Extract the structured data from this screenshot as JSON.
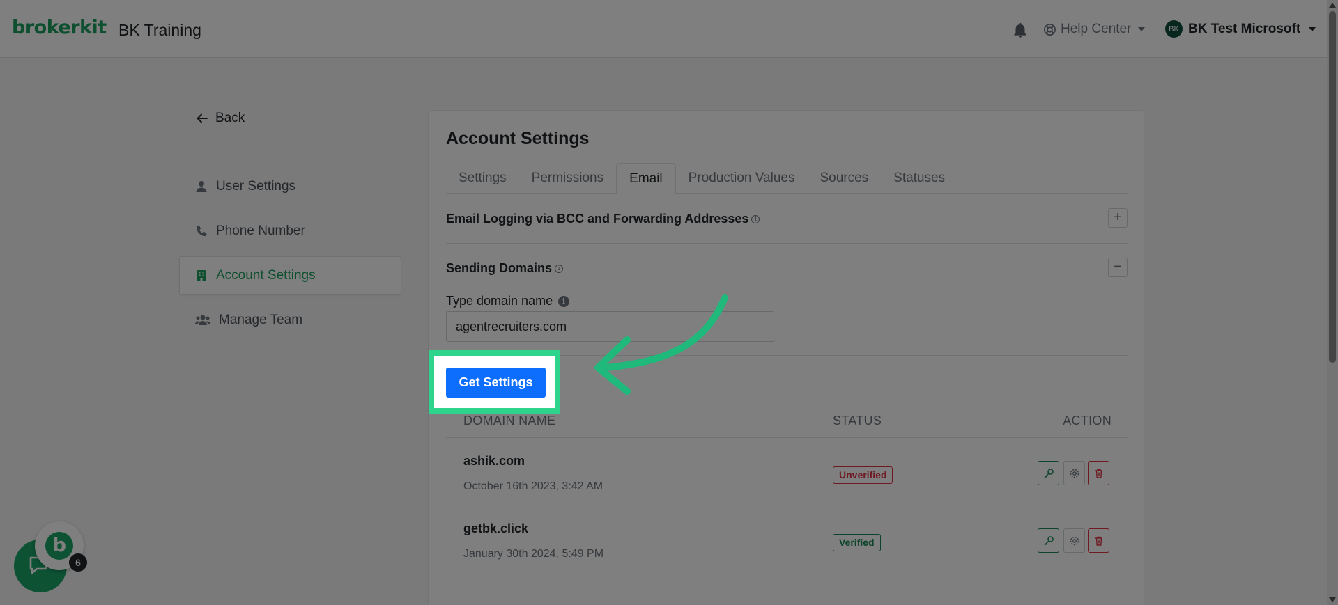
{
  "header": {
    "logo": "brokerkit",
    "org_name": "BK Training",
    "help_center": "Help Center",
    "user_initials": "BK",
    "user_name": "BK Test Microsoft"
  },
  "sidebar": {
    "back_label": "Back",
    "items": [
      {
        "label": "User Settings",
        "icon": "user-icon"
      },
      {
        "label": "Phone Number",
        "icon": "phone-icon"
      },
      {
        "label": "Account Settings",
        "icon": "building-icon",
        "active": true
      },
      {
        "label": "Manage Team",
        "icon": "users-icon"
      }
    ]
  },
  "main": {
    "title": "Account Settings",
    "tabs": [
      "Settings",
      "Permissions",
      "Email",
      "Production Values",
      "Sources",
      "Statuses"
    ],
    "active_tab": "Email",
    "sections": {
      "email_logging": {
        "title": "Email Logging via BCC and Forwarding Addresses",
        "toggle": "+"
      },
      "sending_domains": {
        "title": "Sending Domains",
        "toggle": "−"
      }
    },
    "domain_field": {
      "label": "Type domain name",
      "value": "agentrecruiters.com"
    },
    "get_settings_label": "Get Settings",
    "table": {
      "headers": {
        "domain": "DOMAIN NAME",
        "status": "STATUS",
        "action": "ACTION"
      },
      "rows": [
        {
          "domain": "ashik.com",
          "date": "October 16th 2023, 3:42 AM",
          "status": "Unverified"
        },
        {
          "domain": "getbk.click",
          "date": "January 30th 2024, 5:49 PM",
          "status": "Verified"
        }
      ]
    }
  },
  "chat_widget": {
    "badge_count": "6",
    "bubble_letter": "b"
  },
  "colors": {
    "brand": "#1a9e5c",
    "primary": "#0d6efd",
    "danger": "#dc3545",
    "success": "#198754",
    "highlight": "#2ed38c"
  }
}
